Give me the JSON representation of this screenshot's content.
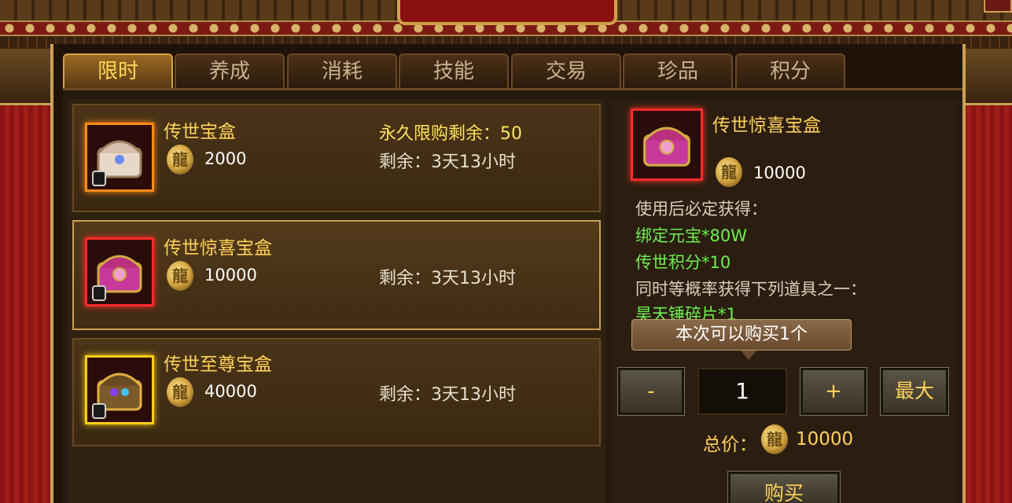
{
  "tabs": [
    {
      "label": "限时",
      "active": true
    },
    {
      "label": "养成",
      "active": false
    },
    {
      "label": "消耗",
      "active": false
    },
    {
      "label": "技能",
      "active": false
    },
    {
      "label": "交易",
      "active": false
    },
    {
      "label": "珍品",
      "active": false
    },
    {
      "label": "积分",
      "active": false
    }
  ],
  "items": [
    {
      "name": "传世宝盒",
      "price": "2000",
      "limit_text": "永久限购剩余：50",
      "remain_text": "剩余：3天13小时",
      "frame_color": "#ff8a1a",
      "selected": false
    },
    {
      "name": "传世惊喜宝盒",
      "price": "10000",
      "limit_text": "",
      "remain_text": "剩余：3天13小时",
      "frame_color": "#ff2a2a",
      "selected": true
    },
    {
      "name": "传世至尊宝盒",
      "price": "40000",
      "limit_text": "",
      "remain_text": "剩余：3天13小时",
      "frame_color": "#ffcc1a",
      "selected": false
    }
  ],
  "detail": {
    "name": "传世惊喜宝盒",
    "price": "10000",
    "lines": [
      {
        "text": "使用后必定获得：",
        "color": "gray"
      },
      {
        "text": "绑定元宝*80W",
        "color": "green"
      },
      {
        "text": "传世积分*10",
        "color": "green"
      },
      {
        "text": "同时等概率获得下列道具之一：",
        "color": "gray"
      },
      {
        "text": "昊天锤碎片*1",
        "color": "green"
      }
    ],
    "tooltip": "本次可以购买1个",
    "minus_label": "-",
    "quantity": "1",
    "plus_label": "+",
    "max_label": "最大",
    "total_label": "总价：",
    "total_value": "10000",
    "buy_label": "购买"
  },
  "icons": {
    "coin": "gold-dragon-coin-icon",
    "lock": "lock-icon",
    "chest": "treasure-chest-icon"
  },
  "colors": {
    "gold_text": "#ffd25a",
    "green_text": "#6ff04e",
    "accent_red": "#ff2a2a"
  }
}
